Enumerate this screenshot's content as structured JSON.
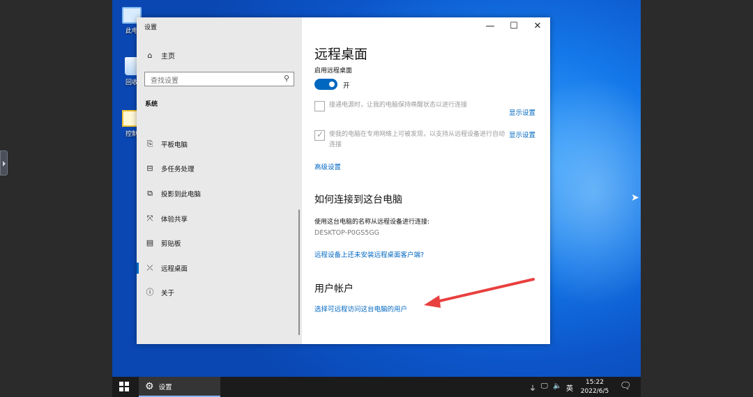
{
  "desktop": {
    "icons": [
      {
        "label": "此电"
      },
      {
        "label": "回收"
      },
      {
        "label": "控制"
      }
    ]
  },
  "window": {
    "title": "设置",
    "controls": {
      "minimize": "—",
      "maximize": "☐",
      "close": "✕"
    }
  },
  "sidebar": {
    "home": {
      "icon": "home-icon",
      "label": "主页"
    },
    "search": {
      "placeholder": "查找设置",
      "icon": "search-icon"
    },
    "section": "系统",
    "items": [
      {
        "icon": "tablet-icon",
        "label": "平板电脑"
      },
      {
        "icon": "multitask-icon",
        "label": "多任务处理"
      },
      {
        "icon": "project-icon",
        "label": "投影到此电脑"
      },
      {
        "icon": "share-icon",
        "label": "体验共享"
      },
      {
        "icon": "clipboard-icon",
        "label": "剪贴板"
      },
      {
        "icon": "remote-desktop-icon",
        "label": "远程桌面",
        "active": true
      },
      {
        "icon": "info-icon",
        "label": "关于"
      }
    ]
  },
  "main": {
    "title": "远程桌面",
    "enable_label": "启用远程桌面",
    "toggle": {
      "on": true,
      "label": "开"
    },
    "option1": {
      "checked": false,
      "text": "接通电源时，让我的电脑保持唤醒状态以进行连接",
      "link": "显示设置"
    },
    "option2": {
      "checked": true,
      "text": "使我的电脑在专用网络上可被发现，以支持从远程设备进行自动连接",
      "link": "显示设置"
    },
    "advanced_link": "高级设置",
    "connect": {
      "heading": "如何连接到这台电脑",
      "desc": "使用这台电脑的名称从远程设备进行连接:",
      "pc_name": "DESKTOP-P0GS5GG",
      "client_link": "远程设备上还未安装远程桌面客户端?"
    },
    "accounts": {
      "heading": "用户帐户",
      "link": "选择可远程访问这台电脑的用户"
    }
  },
  "taskbar": {
    "app_label": "设置",
    "ime": "英",
    "time": "15:22",
    "date": "2022/6/5"
  },
  "colors": {
    "accent": "#0067c0",
    "annotation_arrow": "#e8403f"
  }
}
